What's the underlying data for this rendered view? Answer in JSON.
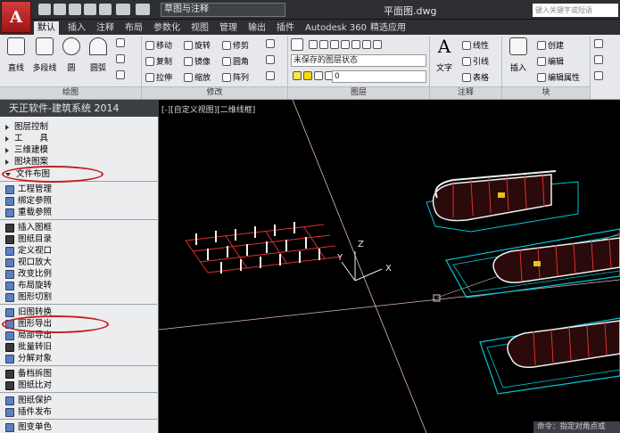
{
  "app": {
    "title": "平面图.dwg",
    "logo": "A",
    "workspace": "草图与注释",
    "search_placeholder": "键入关键字或短语"
  },
  "tabs": [
    "默认",
    "插入",
    "注释",
    "布局",
    "参数化",
    "视图",
    "管理",
    "输出",
    "插件",
    "Autodesk 360",
    "精选应用"
  ],
  "active_tab": "默认",
  "ribbon": {
    "draw": {
      "title": "绘图",
      "tools": [
        "直线",
        "多段线",
        "圆",
        "圆弧"
      ]
    },
    "modify": {
      "title": "修改",
      "rows": [
        [
          "移动",
          "旋转",
          "修剪"
        ],
        [
          "复制",
          "镜像",
          "圆角"
        ],
        [
          "拉伸",
          "缩放",
          "阵列"
        ]
      ]
    },
    "layers": {
      "title": "图层",
      "layer_state": "未保存的图层状态",
      "current_layer": "0"
    },
    "annotation": {
      "title": "注释",
      "big": "文字",
      "items": [
        "线性",
        "引线",
        "表格"
      ]
    },
    "block": {
      "title": "块",
      "big": "插入",
      "items": [
        "创建",
        "编辑",
        "编辑属性"
      ]
    }
  },
  "palette": {
    "title": "天正软件-建筑系统 2014",
    "menu": [
      {
        "label": "图层控制",
        "state": "collapsed"
      },
      {
        "label": "工　　具",
        "state": "collapsed"
      },
      {
        "label": "三维建模",
        "state": "collapsed"
      },
      {
        "label": "图块图案",
        "state": "collapsed"
      },
      {
        "label": "文件布图",
        "state": "expanded"
      }
    ],
    "items": [
      "工程管理",
      "绑定参照",
      "重载参照",
      "插入图框",
      "图纸目录",
      "定义视口",
      "视口放大",
      "改变比例",
      "布局旋转",
      "图形切割",
      "旧图转换",
      "图形导出",
      "局部导出",
      "批量转旧",
      "分解对象",
      "备档拆图",
      "图纸比对",
      "图纸保护",
      "插件发布",
      "图变单色"
    ]
  },
  "viewport": {
    "label": "[-][自定义视图][二维线框]",
    "command_prompt": "命令：指定对角点或"
  },
  "colors": {
    "accent_red": "#c81e1e",
    "model_cyan": "#00c8d8",
    "model_red": "#e03030",
    "bg": "#000000"
  }
}
